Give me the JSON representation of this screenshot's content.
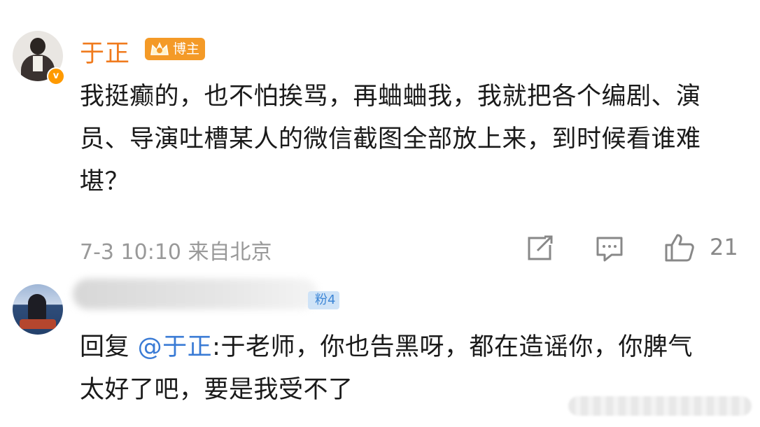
{
  "comments": [
    {
      "author": "于正",
      "badge": "博主",
      "text": "我挺癫的，也不怕挨骂，再蛐蛐我，我就把各个编剧、演员、导演吐槽某人的微信截图全部放上来，到时候看谁难堪？",
      "time": "7-3 10:10",
      "location": "来自北京",
      "likes": "21"
    },
    {
      "fan_badge": "粉4",
      "reply_prefix": "回复",
      "mention": "@于正",
      "reply_text": ":于老师，你也告黑呀，都在造谣你，你脾气太好了吧，要是我受不了"
    }
  ],
  "colors": {
    "author_name": "#f07b1e",
    "vip_badge": "#f49a27",
    "mention": "#3a7bd5",
    "meta": "#999999"
  },
  "icons": {
    "verified": "verified-badge-icon",
    "vip": "crown-icon",
    "forward": "forward-icon",
    "comment": "comment-icon",
    "like": "like-icon"
  }
}
